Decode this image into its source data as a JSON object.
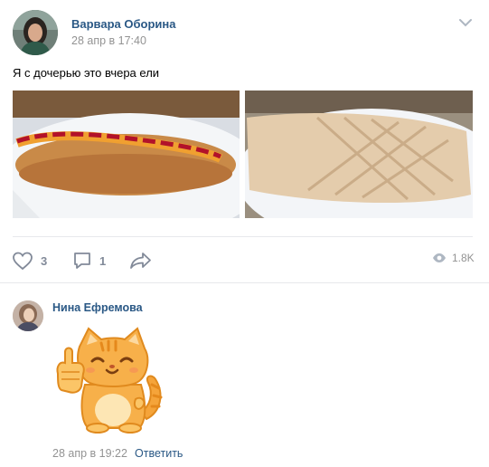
{
  "post": {
    "author": "Варвара Оборина",
    "date": "28 апр в 17:40",
    "text": "Я с дочерью это вчера ели",
    "photos": [
      "hot-dog-photo",
      "shawarma-photo"
    ],
    "actions": {
      "likes": "3",
      "comments": "1",
      "views": "1.8K"
    }
  },
  "comment": {
    "author": "Нина Ефремова",
    "sticker": "cat-thumbs-up-sticker",
    "date": "28 апр в 19:22",
    "reply_label": "Ответить"
  },
  "colors": {
    "link": "#2a5885",
    "muted": "#939393",
    "action": "#828a99",
    "divider": "#e7e8ec"
  }
}
